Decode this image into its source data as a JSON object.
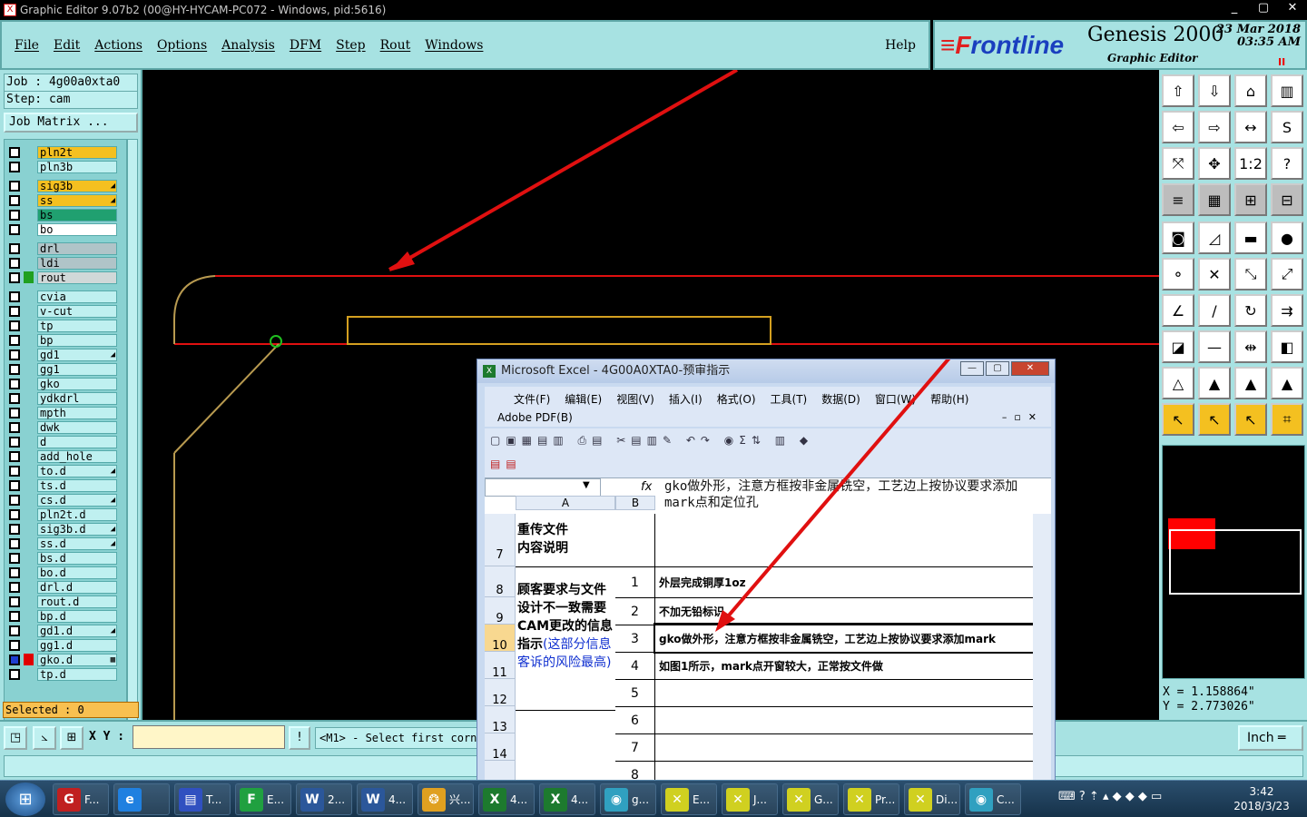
{
  "window": {
    "title": "Graphic Editor 9.07b2 (00@HY-HYCAM-PC072 - Windows, pid:5616)",
    "min": "_",
    "max": "▢",
    "close": "✕"
  },
  "menu": {
    "items": [
      "File",
      "Edit",
      "Actions",
      "Options",
      "Analysis",
      "DFM",
      "Step",
      "Rout",
      "Windows"
    ],
    "help": "Help"
  },
  "brand": {
    "logo_prefix": "≡F",
    "logo": "rontline",
    "product": "Genesis 2000",
    "subtitle": "Graphic Editor",
    "date": "23 Mar 2018",
    "time": "03:35 AM",
    "pause": "II"
  },
  "job": {
    "job_label": "Job : 4g00a0xta0",
    "step_label": "Step: cam",
    "matrix_button": "Job Matrix ..."
  },
  "layers": [
    {
      "name": "pln2t",
      "color": "#f4c020",
      "arrow": ""
    },
    {
      "name": "pln3b",
      "color": "#bff0f0",
      "arrow": ""
    },
    {
      "name": "sig3b",
      "color": "#f4c020",
      "arrow": "◢"
    },
    {
      "name": "ss",
      "color": "#f4c020",
      "arrow": "◢"
    },
    {
      "name": "bs",
      "color": "#20a070",
      "arrow": ""
    },
    {
      "name": "bo",
      "color": "#ffffff",
      "arrow": ""
    },
    {
      "name": "drl",
      "color": "#b0c4c8",
      "arrow": ""
    },
    {
      "name": "ldi",
      "color": "#b0c4c8",
      "arrow": ""
    },
    {
      "name": "rout",
      "color": "#d0d8d8",
      "arrow": "",
      "swatch": "#20a020"
    },
    {
      "name": "cvia",
      "color": "#bff0f0",
      "arrow": ""
    },
    {
      "name": "v-cut",
      "color": "#bff0f0",
      "arrow": ""
    },
    {
      "name": "tp",
      "color": "#bff0f0",
      "arrow": ""
    },
    {
      "name": "bp",
      "color": "#bff0f0",
      "arrow": ""
    },
    {
      "name": "gd1",
      "color": "#bff0f0",
      "arrow": "◢"
    },
    {
      "name": "gg1",
      "color": "#bff0f0",
      "arrow": ""
    },
    {
      "name": "gko",
      "color": "#bff0f0",
      "arrow": ""
    },
    {
      "name": "ydkdrl",
      "color": "#bff0f0",
      "arrow": ""
    },
    {
      "name": "mpth",
      "color": "#bff0f0",
      "arrow": ""
    },
    {
      "name": "dwk",
      "color": "#bff0f0",
      "arrow": ""
    },
    {
      "name": "d",
      "color": "#bff0f0",
      "arrow": ""
    },
    {
      "name": "add_hole",
      "color": "#bff0f0",
      "arrow": ""
    },
    {
      "name": "to.d",
      "color": "#bff0f0",
      "arrow": "◢"
    },
    {
      "name": "ts.d",
      "color": "#bff0f0",
      "arrow": ""
    },
    {
      "name": "cs.d",
      "color": "#bff0f0",
      "arrow": "◢"
    },
    {
      "name": "pln2t.d",
      "color": "#bff0f0",
      "arrow": ""
    },
    {
      "name": "sig3b.d",
      "color": "#bff0f0",
      "arrow": "◢"
    },
    {
      "name": "ss.d",
      "color": "#bff0f0",
      "arrow": "◢"
    },
    {
      "name": "bs.d",
      "color": "#bff0f0",
      "arrow": ""
    },
    {
      "name": "bo.d",
      "color": "#bff0f0",
      "arrow": ""
    },
    {
      "name": "drl.d",
      "color": "#bff0f0",
      "arrow": ""
    },
    {
      "name": "rout.d",
      "color": "#bff0f0",
      "arrow": ""
    },
    {
      "name": "bp.d",
      "color": "#bff0f0",
      "arrow": ""
    },
    {
      "name": "gd1.d",
      "color": "#bff0f0",
      "arrow": "◢"
    },
    {
      "name": "gg1.d",
      "color": "#bff0f0",
      "arrow": ""
    },
    {
      "name": "gko.d",
      "color": "#bff0f0",
      "arrow": "▦",
      "selected": true,
      "swatch": "#e00000"
    },
    {
      "name": "tp.d",
      "color": "#bff0f0",
      "arrow": ""
    }
  ],
  "selected": "Selected : 0",
  "toolbar": {
    "buttons": [
      "⇧",
      "⇩",
      "⌂",
      "▥",
      "⇦",
      "⇨",
      "↔",
      "S",
      "⤧",
      "✥",
      "1:2",
      "?",
      "≡",
      "▦",
      "⊞",
      "⊟",
      "◙",
      "◿",
      "▬",
      "●",
      "⚬",
      "✕",
      "⤡",
      "⤢",
      "∠",
      "/",
      "↻",
      "⇉",
      "◪",
      "—",
      "⇹",
      "◧",
      "△",
      "▲",
      "▲",
      "▲",
      "↖",
      "↖",
      "↖",
      "⌗"
    ]
  },
  "coords": {
    "x": "X = 1.158864\"",
    "y": "Y = 2.773026\""
  },
  "command": {
    "xy_label": "X Y :",
    "xy_value": "",
    "message": "<M1> - Select first corne",
    "unit": "Inch ═"
  },
  "excel": {
    "title": "Microsoft Excel - 4G00A0XTA0-预审指示",
    "menu": [
      "文件(F)",
      "编辑(E)",
      "视图(V)",
      "插入(I)",
      "格式(O)",
      "工具(T)",
      "数据(D)",
      "窗口(W)",
      "帮助(H)"
    ],
    "pdf": "Adobe PDF(B)",
    "formula": "gko做外形，注意方框按非金属铣空，工艺边上按协议要求添加mark点和定位孔",
    "fx": "fx",
    "col_a": "A",
    "col_b": "B",
    "rows": [
      {
        "num": "7",
        "a": "重传文件\n内容说明",
        "n": "",
        "b": ""
      },
      {
        "num": "8",
        "a": "",
        "n": "1",
        "b": "外层完成铜厚1oz"
      },
      {
        "num": "9",
        "a": "",
        "n": "2",
        "b": "不加无铅标识"
      },
      {
        "num": "10",
        "a": "",
        "n": "3",
        "b": "gko做外形，注意方框按非金属铣空，工艺边上按协议要求添加mark"
      },
      {
        "num": "11",
        "a": "",
        "n": "4",
        "b": "如图1所示，mark点开窗较大，正常按文件做"
      },
      {
        "num": "12",
        "a": "",
        "n": "5",
        "b": ""
      },
      {
        "num": "13",
        "a": "",
        "n": "6",
        "b": ""
      },
      {
        "num": "14",
        "a": "",
        "n": "7",
        "b": ""
      },
      {
        "num": "",
        "a": "",
        "n": "8",
        "b": ""
      }
    ],
    "block_label": "顾客要求与文件设计不一致需要CAM更改的信息指示",
    "block_note": "(这部分信息客诉的风险最高)"
  },
  "taskbar": {
    "items": [
      {
        "label": "F...",
        "icon": "G",
        "color": "#c02020"
      },
      {
        "label": "",
        "icon": "e",
        "color": "#2080e0"
      },
      {
        "label": "T...",
        "icon": "▤",
        "color": "#3050c0"
      },
      {
        "label": "E...",
        "icon": "F",
        "color": "#20a040"
      },
      {
        "label": "2...",
        "icon": "W",
        "color": "#2b579a"
      },
      {
        "label": "4...",
        "icon": "W",
        "color": "#2b579a"
      },
      {
        "label": "兴...",
        "icon": "❂",
        "color": "#e0a020"
      },
      {
        "label": "4...",
        "icon": "X",
        "color": "#1d7a2e"
      },
      {
        "label": "4...",
        "icon": "X",
        "color": "#1d7a2e"
      },
      {
        "label": "g...",
        "icon": "◉",
        "color": "#30a0c0"
      },
      {
        "label": "E...",
        "icon": "✕",
        "color": "#d0d020"
      },
      {
        "label": "J...",
        "icon": "✕",
        "color": "#d0d020"
      },
      {
        "label": "G...",
        "icon": "✕",
        "color": "#d0d020"
      },
      {
        "label": "Pr...",
        "icon": "✕",
        "color": "#d0d020"
      },
      {
        "label": "Di...",
        "icon": "✕",
        "color": "#d0d020"
      },
      {
        "label": "C...",
        "icon": "◉",
        "color": "#30a0c0"
      }
    ],
    "time": "3:42",
    "date": "2018/3/23"
  }
}
